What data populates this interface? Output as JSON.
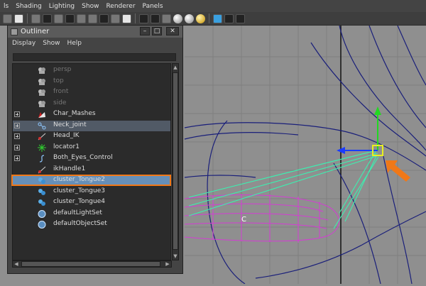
{
  "menubar": {
    "items": [
      "ls",
      "Shading",
      "Lighting",
      "Show",
      "Renderer",
      "Panels"
    ]
  },
  "toolbar": {
    "icons": [
      "camera-icon",
      "bookmark-icon",
      "image-plane-icon",
      "2d-pan-icon",
      "grid-icon",
      "film-gate-icon",
      "resolution-gate-icon",
      "gate-mask-icon",
      "field-chart-icon",
      "safe-action-icon",
      "safe-title-icon",
      "wireframe-icon",
      "smooth-shade-icon",
      "default-material-icon",
      "xray-icon",
      "textured-icon",
      "use-lights-icon",
      "isolate-select-icon",
      "xray-joints-icon",
      "component-xray-icon"
    ]
  },
  "outliner": {
    "title": "Outliner",
    "menu": [
      "Display",
      "Show",
      "Help"
    ],
    "filter_value": "",
    "items": [
      {
        "label": "persp",
        "icon": "camera-icon",
        "expandable": false,
        "dim": true
      },
      {
        "label": "top",
        "icon": "camera-icon",
        "expandable": false,
        "dim": true
      },
      {
        "label": "front",
        "icon": "camera-icon",
        "expandable": false,
        "dim": true
      },
      {
        "label": "side",
        "icon": "camera-icon",
        "expandable": false,
        "dim": true
      },
      {
        "label": "Char_Mashes",
        "icon": "mesh-icon",
        "expandable": true,
        "dim": false
      },
      {
        "label": "Neck_joint",
        "icon": "joint-icon",
        "expandable": true,
        "dim": false
      },
      {
        "label": "Head_IK",
        "icon": "ik-handle-icon",
        "expandable": true,
        "dim": false
      },
      {
        "label": "locator1",
        "icon": "locator-icon",
        "expandable": true,
        "dim": false
      },
      {
        "label": "Both_Eyes_Control",
        "icon": "curve-icon",
        "expandable": true,
        "dim": false
      },
      {
        "label": "ikHandle1",
        "icon": "ik-handle-icon",
        "expandable": false,
        "dim": false
      },
      {
        "label": "cluster_Tongue2",
        "icon": "cluster-icon",
        "expandable": false,
        "dim": false
      },
      {
        "label": "cluster_Tongue3",
        "icon": "cluster-icon",
        "expandable": false,
        "dim": false
      },
      {
        "label": "cluster_Tongue4",
        "icon": "cluster-icon",
        "expandable": false,
        "dim": false
      },
      {
        "label": "defaultLightSet",
        "icon": "set-icon",
        "expandable": false,
        "dim": false
      },
      {
        "label": "defaultObjectSet",
        "icon": "set-icon",
        "expandable": false,
        "dim": false
      }
    ],
    "selected_label": "Neck_joint",
    "highlighted_label": "cluster_Tongue2"
  },
  "viewport": {
    "cluster_label": "C",
    "colors": {
      "background": "#8f8f8f",
      "wireframe": "#1a1f7a",
      "tongue": "#d43cd4",
      "influence": "#3cf0b0",
      "manip_y": "#22d822",
      "manip_x": "#1a3cff",
      "manip_center": "#e8f020",
      "pointer": "#f07818"
    }
  }
}
